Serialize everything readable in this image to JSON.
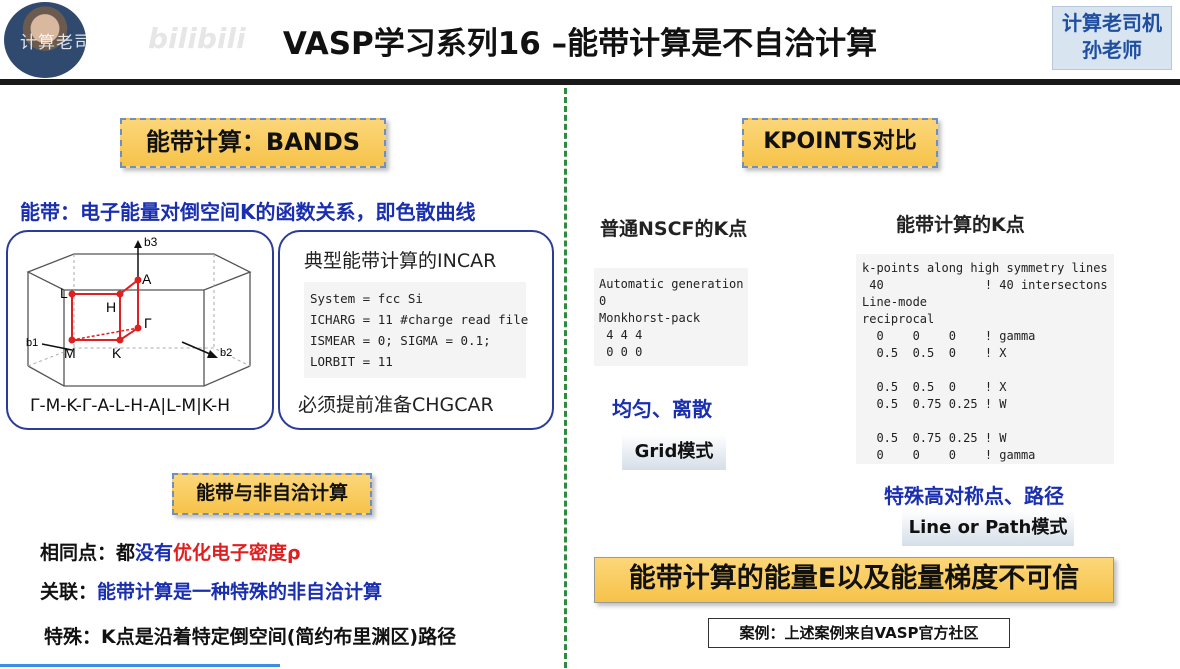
{
  "header": {
    "watermark_text": "计算老司机",
    "watermark_logo": "bilibili",
    "title": "VASP学习系列16 –能带计算是不自洽计算",
    "badge_line1": "计算老司机",
    "badge_line2": "孙老师"
  },
  "left": {
    "bands_title": "能带计算：BANDS",
    "band_definition": "能带：电子能量对倒空间K的函数关系，即色散曲线",
    "bz": {
      "labels": {
        "b3": "b3",
        "A": "A",
        "L": "L",
        "H": "H",
        "Gamma": "Γ",
        "b1": "b1",
        "M": "M",
        "K": "K",
        "b2": "b2"
      },
      "path": "Γ-M-K-Γ-A-L-H-A|L-M|K-H"
    },
    "incar": {
      "heading": "典型能带计算的INCAR",
      "lines": [
        "System = fcc Si",
        "ICHARG = 11 #charge read file",
        "ISMEAR = 0; SIGMA = 0.1;",
        "LORBIT = 11"
      ],
      "note": "必须提前准备CHGCAR"
    },
    "nscf_title": "能带与非自洽计算",
    "same": {
      "label": "相同点：都",
      "blue": "没有",
      "red": "优化电子密度ρ"
    },
    "relation": {
      "label": "关联：",
      "blue": "能带计算是一种特殊的非自洽计算"
    },
    "special": {
      "label": "特殊：K点是沿着特定倒空间(简约布里渊区)路径"
    }
  },
  "right": {
    "kpoints_title": "KPOINTS对比",
    "nscf_heading": "普通NSCF的K点",
    "band_k_heading": "能带计算的K点",
    "nscf_code": [
      "Automatic generation",
      "0",
      "Monkhorst-pack",
      " 4 4 4",
      " 0 0 0"
    ],
    "line_code": [
      "k-points along high symmetry lines",
      " 40              ! 40 intersectons",
      "Line-mode",
      "reciprocal",
      "  0    0    0    ! gamma",
      "  0.5  0.5  0    ! X",
      "",
      "  0.5  0.5  0    ! X",
      "  0.5  0.75 0.25 ! W",
      "",
      "  0.5  0.75 0.25 ! W",
      "  0    0    0    ! gamma"
    ],
    "uniform": "均匀、离散",
    "grid_mode": "Grid模式",
    "special": "特殊高对称点、路径",
    "line_mode": "Line or Path模式",
    "big_claim": "能带计算的能量E以及能量梯度不可信",
    "case": "案例：上述案例来自VASP官方社区"
  },
  "colors": {
    "accent_blue": "#1a2fb0",
    "accent_red": "#e02020",
    "divider_green": "#2e8b3e",
    "title_box": "#f6c34a"
  }
}
